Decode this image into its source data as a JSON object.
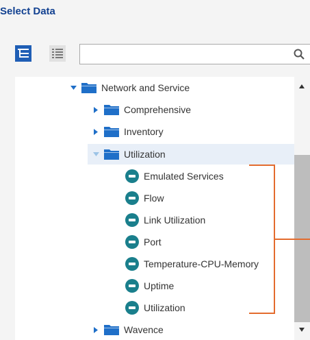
{
  "header": {
    "title": "Select Data"
  },
  "toolbar": {
    "tree_view_icon": "tree-view-icon",
    "list_view_icon": "list-view-icon",
    "search": {
      "value": "",
      "placeholder": "",
      "icon": "search-icon"
    }
  },
  "colors": {
    "accent": "#124191",
    "folder": "#1f6fc8",
    "leaf_icon": "#1a7f8c",
    "selection": "#e8eff8",
    "callout": "#e36b2d"
  },
  "tree": {
    "root": {
      "label": "Network and Service",
      "expanded": true
    },
    "folders": [
      {
        "label": "Comprehensive",
        "expanded": false
      },
      {
        "label": "Inventory",
        "expanded": false
      },
      {
        "label": "Utilization",
        "expanded": true,
        "selected": true
      },
      {
        "label": "Wavence",
        "expanded": false
      }
    ],
    "leaves": [
      {
        "label": "Emulated Services"
      },
      {
        "label": "Flow"
      },
      {
        "label": "Link Utilization"
      },
      {
        "label": "Port"
      },
      {
        "label": "Temperature-CPU-Memory"
      },
      {
        "label": "Uptime"
      },
      {
        "label": "Utilization"
      }
    ]
  }
}
